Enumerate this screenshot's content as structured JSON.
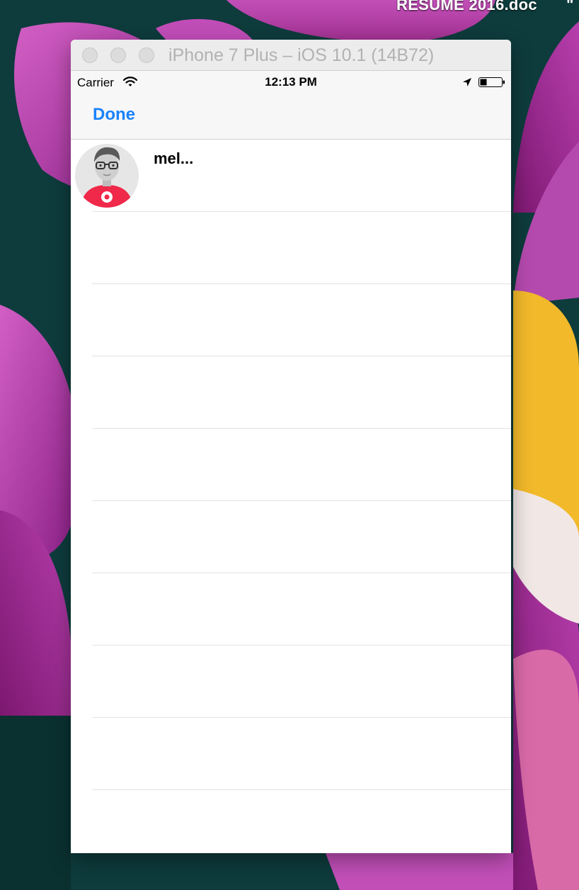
{
  "desktop": {
    "file_label": "RESUME 2016.doc",
    "marker": "\""
  },
  "window": {
    "title": "iPhone 7 Plus – iOS 10.1 (14B72)"
  },
  "status_bar": {
    "carrier": "Carrier",
    "time": "12:13 PM"
  },
  "nav": {
    "done_label": "Done"
  },
  "contacts": [
    {
      "name": "mel..."
    }
  ],
  "empty_row_count": 9,
  "colors": {
    "tint": "#1a82fb",
    "avatar_shirt": "#f0284a"
  }
}
